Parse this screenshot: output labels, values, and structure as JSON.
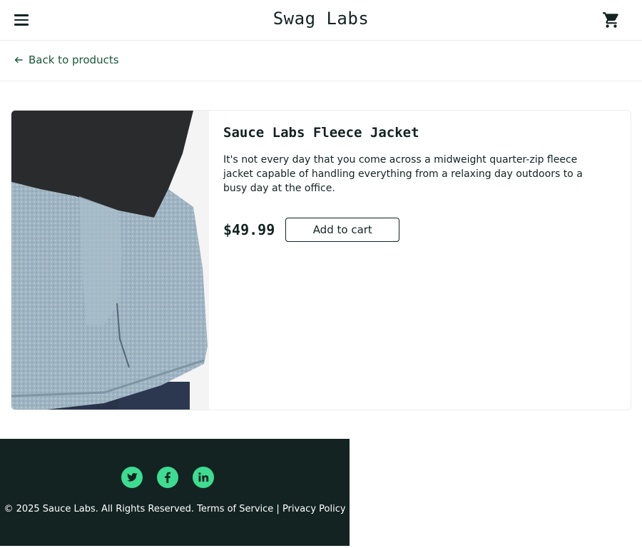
{
  "app": {
    "title": "Swag Labs",
    "accent_color": "#3ddc91",
    "dark_color": "#132322",
    "link_color": "#18583a"
  },
  "header": {
    "menu_icon": "menu-icon",
    "cart_icon": "shopping-cart-icon"
  },
  "subheader": {
    "back_label": "Back to products",
    "back_icon": "arrow-left-icon"
  },
  "product": {
    "name": "Sauce Labs Fleece Jacket",
    "description": "It's not every day that you come across a midweight quarter-zip fleece jacket capable of handling everything from a relaxing day outdoors to a busy day at the office.",
    "price": "$49.99",
    "add_label": "Add to cart"
  },
  "footer": {
    "social": [
      "twitter-icon",
      "facebook-icon",
      "linkedin-icon"
    ],
    "copyright": "© 2025 Sauce Labs. All Rights Reserved. Terms of Service | Privacy Policy"
  }
}
